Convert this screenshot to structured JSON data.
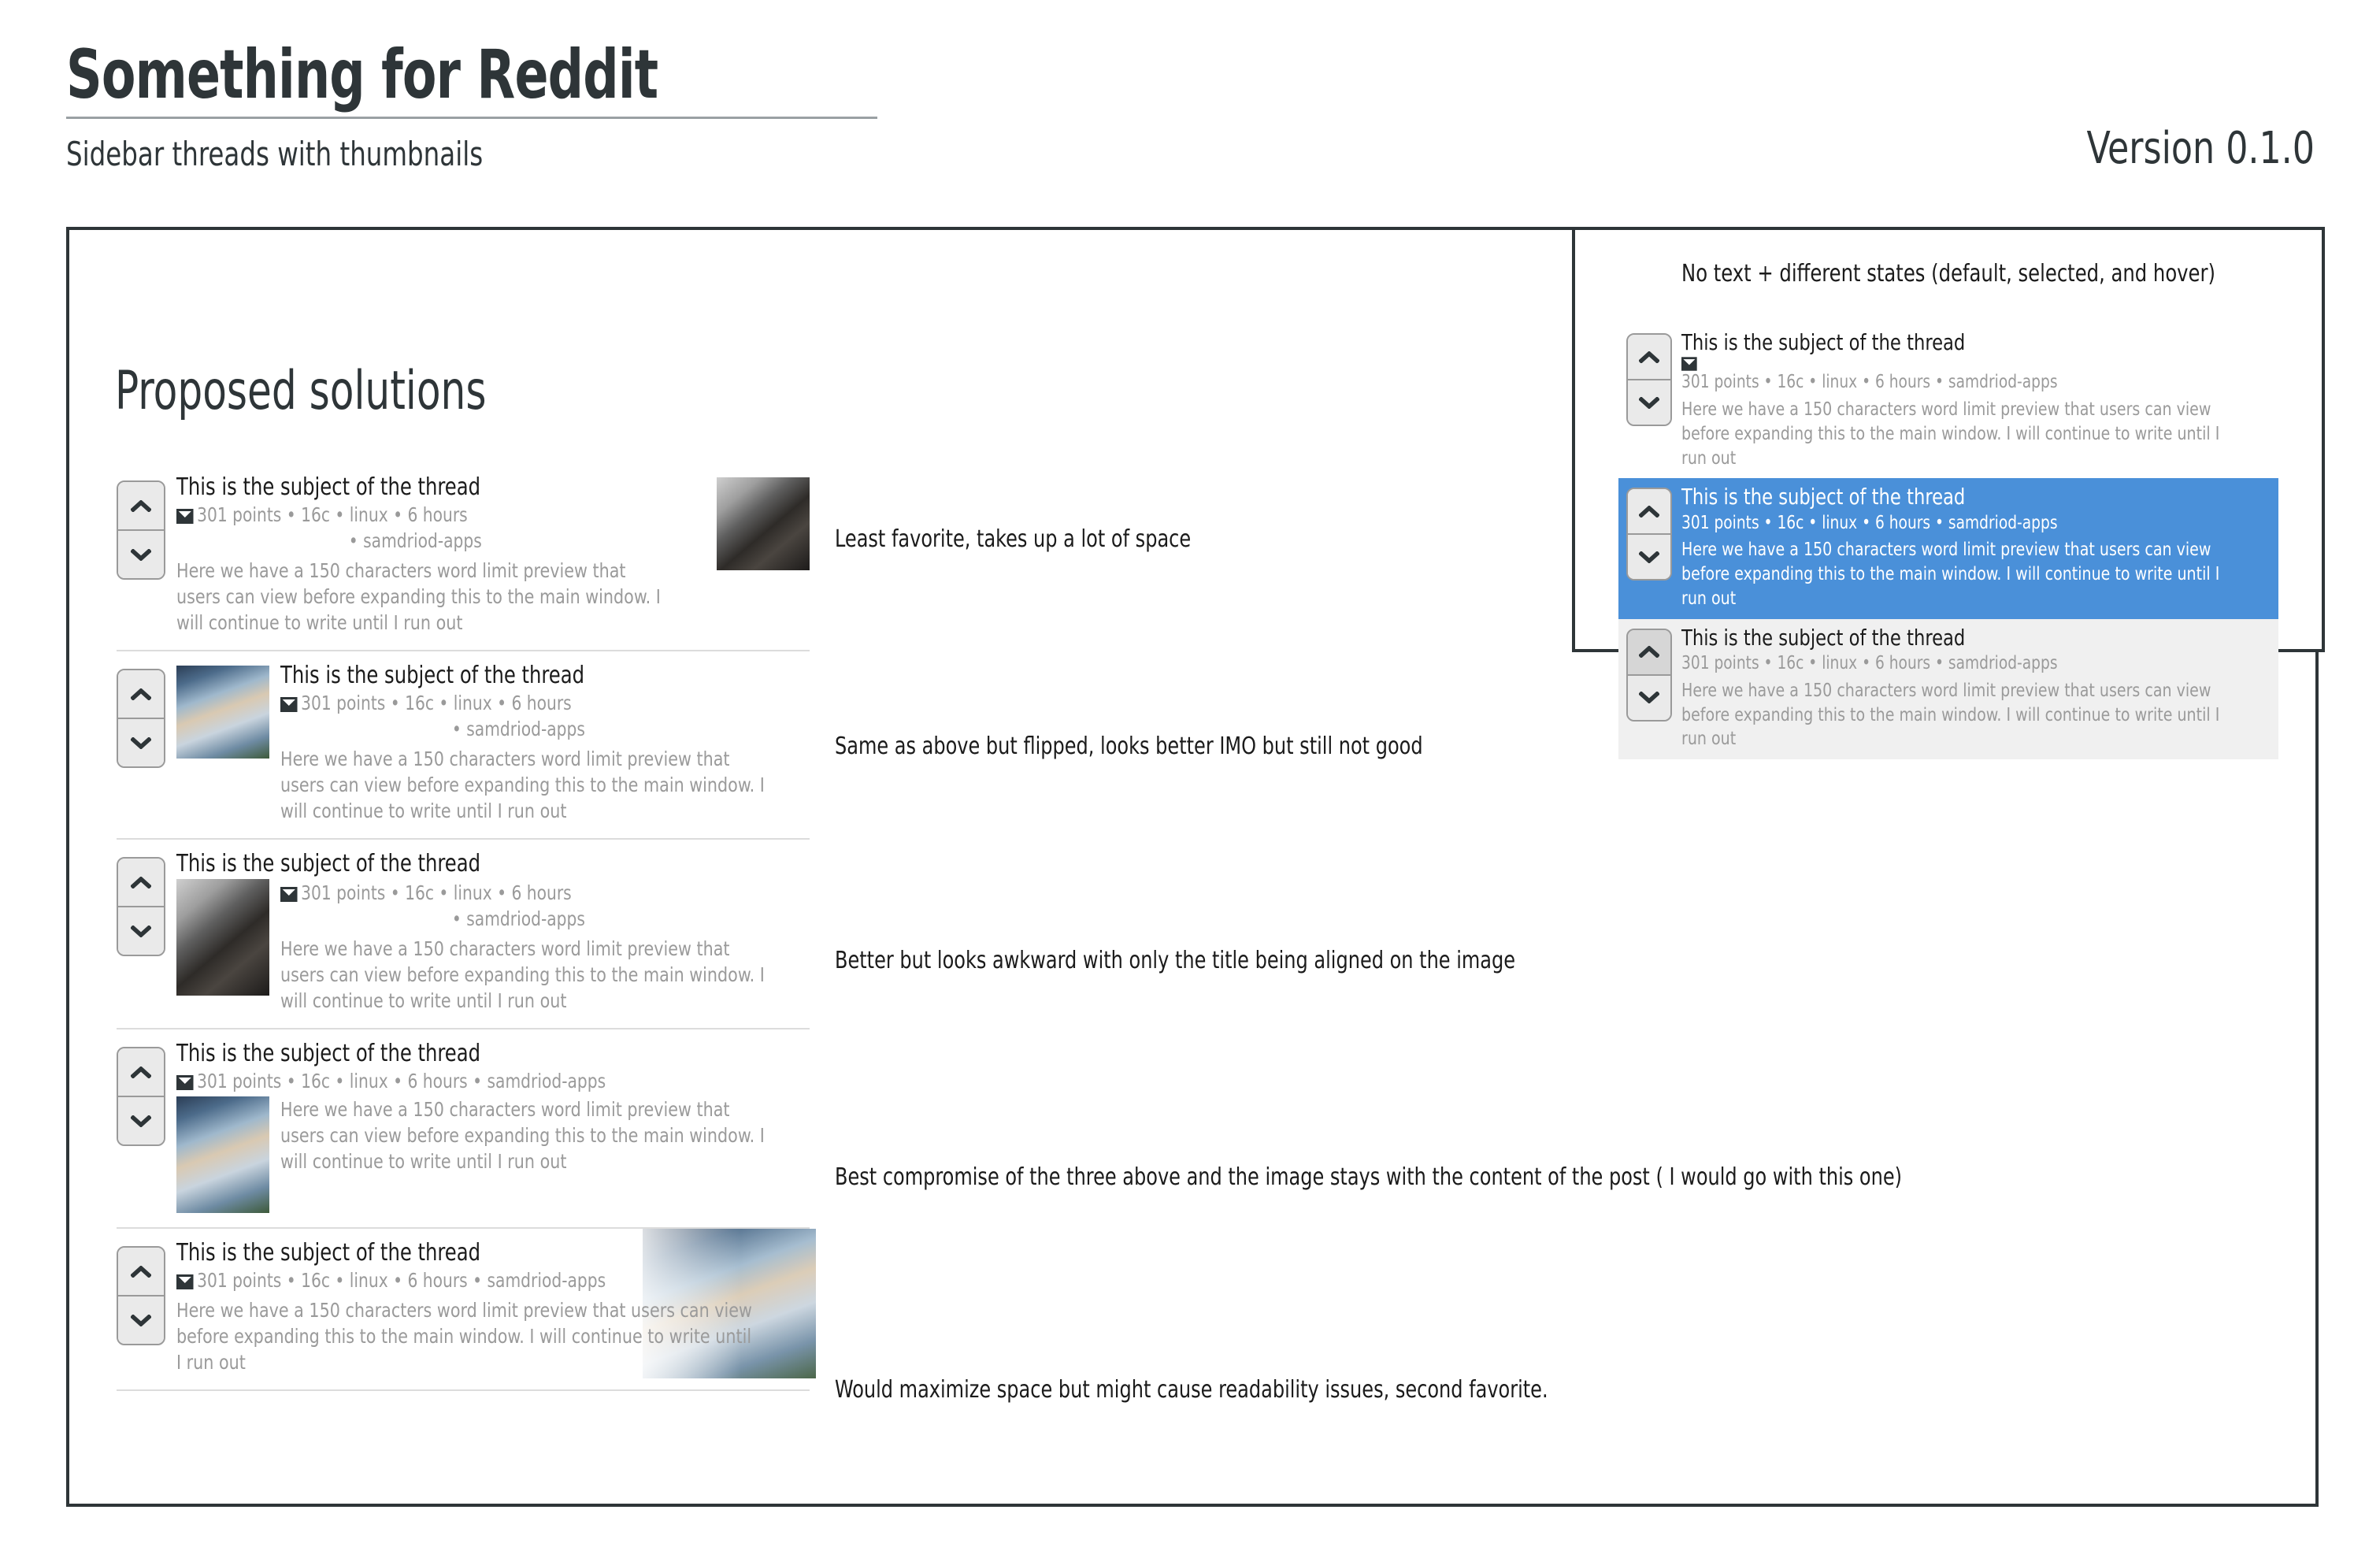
{
  "header": {
    "app_title": "Something for Reddit",
    "subtitle": "Sidebar threads with thumbnails",
    "version": "Version 0.1.0"
  },
  "section": {
    "title": "Proposed solutions"
  },
  "thread_template": {
    "title": "This is the subject of the thread",
    "meta_points": "301 points",
    "meta_comments": "16c",
    "meta_sub": "linux",
    "meta_age": "6 hours",
    "meta_author": "samdriod-apps",
    "meta_inline": "301 points • 16c • linux • 6 hours • samdriod-apps",
    "meta_wrapped_line1": "301 points • 16c • linux • 6 hours",
    "meta_wrapped_line2": "• samdriod-apps",
    "preview": "Here we have a 150 characters word limit preview that users can view before expanding this to the main window. I will continue to write until I run out",
    "mail_icon": "envelope-icon",
    "upvote_icon": "chevron-up-icon",
    "downvote_icon": "chevron-down-icon"
  },
  "solutions": [
    {
      "id": "solution-1",
      "layout": "text-left-thumb-right",
      "title": "This is the subject of the thread",
      "meta_line1": "301 points • 16c • linux • 6 hours",
      "meta_line2": "• samdriod-apps",
      "preview": "Here we have a 150 characters word limit preview that users can view before expanding this to the main window. I will continue to write until I run out",
      "annotation": "Least favorite, takes up a lot of space",
      "thumbnail": "portrait-bearded-man"
    },
    {
      "id": "solution-2",
      "layout": "thumb-left-text-right",
      "title": "This is the subject of the thread",
      "meta_line1": "301 points • 16c • linux • 6 hours",
      "meta_line2": "• samdriod-apps",
      "preview": "Here we have a 150 characters word limit preview that users can view before expanding this to the main window. I will continue to write until I run out",
      "annotation": "Same as above but flipped, looks better IMO but still not good",
      "thumbnail": "portrait-man-blue-shirt"
    },
    {
      "id": "solution-3",
      "layout": "title-full-then-thumb-left",
      "title": "This is the subject of the thread",
      "meta_line1": "301 points • 16c • linux • 6 hours",
      "meta_line2": "• samdriod-apps",
      "preview": "Here we have a 150 characters word limit preview that users can view before expanding this to the main window. I will continue to write until I run out",
      "annotation": "Better but looks awkward with only the title being aligned on the image",
      "thumbnail": "portrait-bearded-man"
    },
    {
      "id": "solution-4",
      "layout": "title-meta-full-then-thumb-left",
      "title": "This is the subject of the thread",
      "meta_line1": "301 points • 16c • linux • 6 hours • samdriod-apps",
      "preview": "Here we have a 150 characters word limit preview that users can view before expanding this to the main window. I will continue to write until I run out",
      "annotation": "Best compromise of the three above and the image stays with the content of the post ( I would go with this one)",
      "thumbnail": "portrait-man-blue-shirt"
    },
    {
      "id": "solution-5",
      "layout": "image-bleed-background",
      "title": "This is the subject of the thread",
      "meta_line1": "301 points • 16c • linux • 6 hours • samdriod-apps",
      "preview": "Here we have a 150 characters word limit preview that users can view before expanding this to the main window. I will continue to write until I run out",
      "annotation": "Would maximize space but might cause readability issues, second favorite.",
      "thumbnail": "portrait-man-blue-shirt"
    }
  ],
  "states_panel": {
    "caption": "No text + different states (default, selected, and hover)",
    "items": [
      {
        "state": "default",
        "title": "This is the subject of the thread",
        "meta": "301 points • 16c • linux • 6 hours • samdriod-apps",
        "preview": "Here we have a 150 characters word limit preview that users can view before expanding this to the main window. I will continue to write until I run out",
        "has_mail_icon": true
      },
      {
        "state": "selected",
        "title": "This is the subject of the thread",
        "meta": "301 points • 16c • linux • 6 hours • samdriod-apps",
        "preview": "Here we have a 150 characters word limit preview that users can view before expanding this to the main window. I will continue to write until I run out",
        "has_mail_icon": false
      },
      {
        "state": "hover",
        "title": "This is the subject of the thread",
        "meta": "301 points • 16c • linux • 6 hours • samdriod-apps",
        "preview": "Here we have a 150 characters word limit preview that users can view before expanding this to the main window. I will continue to write until I run out",
        "has_mail_icon": false
      }
    ]
  },
  "colors": {
    "frame_border": "#2e3538",
    "selected_background": "#4a90d9",
    "hover_background": "#f0f0f0",
    "muted_text": "#9a9a9a",
    "primary_text": "#1b1b1b",
    "button_face": "#eaeaea",
    "button_face_active": "#d6d6d6",
    "button_border": "#9a9a9a",
    "separator": "#dcdcdc"
  }
}
